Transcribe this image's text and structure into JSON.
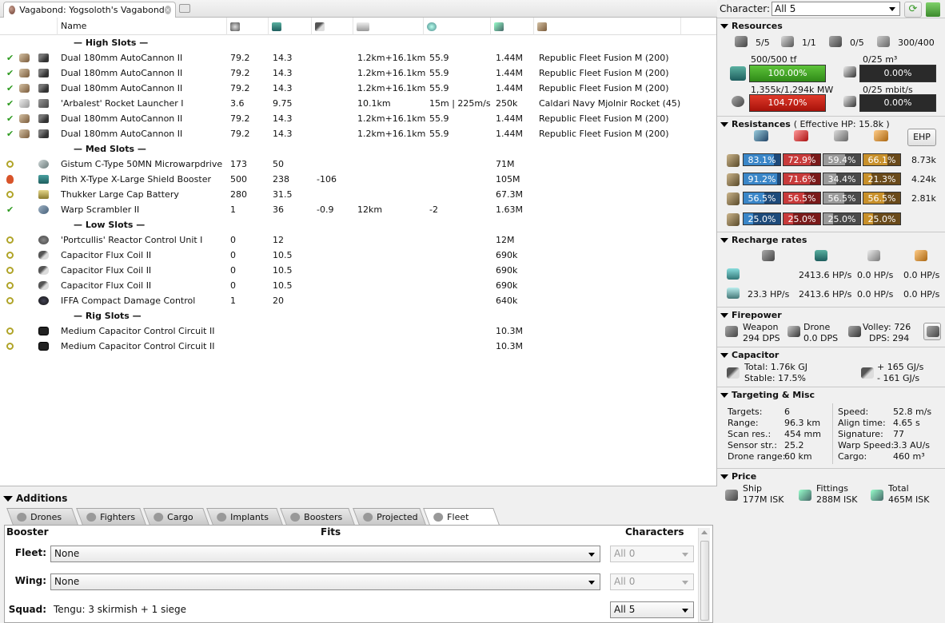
{
  "document_tab": {
    "title": "Vagabond: Yogsoloth's Vagabond",
    "close": "×"
  },
  "fitting": {
    "columns": {
      "name": "Name"
    },
    "rows": [
      {
        "section": "— High Slots —"
      },
      {
        "state": "check",
        "ammo_icon": true,
        "module_icon": "gun",
        "name": "Dual 180mm AutoCannon II",
        "cpu": "79.2",
        "pg": "14.3",
        "cap": "",
        "range": "1.2km+16.1km",
        "speed": "55.9",
        "price": "1.44M",
        "ammo": "Republic Fleet Fusion M (200)"
      },
      {
        "state": "check",
        "ammo_icon": true,
        "module_icon": "gun",
        "name": "Dual 180mm AutoCannon II",
        "cpu": "79.2",
        "pg": "14.3",
        "cap": "",
        "range": "1.2km+16.1km",
        "speed": "55.9",
        "price": "1.44M",
        "ammo": "Republic Fleet Fusion M (200)"
      },
      {
        "state": "check",
        "ammo_icon": true,
        "module_icon": "gun",
        "name": "Dual 180mm AutoCannon II",
        "cpu": "79.2",
        "pg": "14.3",
        "cap": "",
        "range": "1.2km+16.1km",
        "speed": "55.9",
        "price": "1.44M",
        "ammo": "Republic Fleet Fusion M (200)"
      },
      {
        "state": "check",
        "ammo_icon": "rocket",
        "module_icon": "launch",
        "name": "'Arbalest' Rocket Launcher I",
        "cpu": "3.6",
        "pg": "9.75",
        "cap": "",
        "range": "10.1km",
        "speed": "15m | 225m/s",
        "price": "250k",
        "ammo": "Caldari Navy Mjolnir Rocket (45)"
      },
      {
        "state": "check",
        "ammo_icon": true,
        "module_icon": "gun",
        "name": "Dual 180mm AutoCannon II",
        "cpu": "79.2",
        "pg": "14.3",
        "cap": "",
        "range": "1.2km+16.1km",
        "speed": "55.9",
        "price": "1.44M",
        "ammo": "Republic Fleet Fusion M (200)"
      },
      {
        "state": "check",
        "ammo_icon": true,
        "module_icon": "gun",
        "name": "Dual 180mm AutoCannon II",
        "cpu": "79.2",
        "pg": "14.3",
        "cap": "",
        "range": "1.2km+16.1km",
        "speed": "55.9",
        "price": "1.44M",
        "ammo": "Republic Fleet Fusion M (200)"
      },
      {
        "section": "— Med Slots —"
      },
      {
        "state": "ring",
        "module_icon": "mwd",
        "name": "Gistum C-Type 50MN Microwarpdrive",
        "cpu": "173",
        "pg": "50",
        "cap": "",
        "range": "",
        "speed": "",
        "price": "71M",
        "ammo": ""
      },
      {
        "state": "flame",
        "module_icon": "shield",
        "name": "Pith X-Type X-Large Shield Booster",
        "cpu": "500",
        "pg": "238",
        "cap": "-106",
        "range": "",
        "speed": "",
        "price": "105M",
        "ammo": ""
      },
      {
        "state": "ring",
        "module_icon": "cap",
        "name": "Thukker Large Cap Battery",
        "cpu": "280",
        "pg": "31.5",
        "cap": "",
        "range": "",
        "speed": "",
        "price": "67.3M",
        "ammo": ""
      },
      {
        "state": "check",
        "module_icon": "scram",
        "name": "Warp Scrambler II",
        "cpu": "1",
        "pg": "36",
        "cap": "-0.9",
        "range": "12km",
        "speed": "-2",
        "price": "1.63M",
        "ammo": ""
      },
      {
        "section": "— Low Slots —"
      },
      {
        "state": "ring",
        "module_icon": "rcu",
        "name": "'Portcullis' Reactor Control Unit I",
        "cpu": "0",
        "pg": "12",
        "cap": "",
        "range": "",
        "speed": "",
        "price": "12M",
        "ammo": ""
      },
      {
        "state": "ring",
        "module_icon": "flux",
        "name": "Capacitor Flux Coil II",
        "cpu": "0",
        "pg": "10.5",
        "cap": "",
        "range": "",
        "speed": "",
        "price": "690k",
        "ammo": ""
      },
      {
        "state": "ring",
        "module_icon": "flux",
        "name": "Capacitor Flux Coil II",
        "cpu": "0",
        "pg": "10.5",
        "cap": "",
        "range": "",
        "speed": "",
        "price": "690k",
        "ammo": ""
      },
      {
        "state": "ring",
        "module_icon": "flux",
        "name": "Capacitor Flux Coil II",
        "cpu": "0",
        "pg": "10.5",
        "cap": "",
        "range": "",
        "speed": "",
        "price": "690k",
        "ammo": ""
      },
      {
        "state": "ring",
        "module_icon": "dc",
        "name": "IFFA Compact Damage Control",
        "cpu": "1",
        "pg": "20",
        "cap": "",
        "range": "",
        "speed": "",
        "price": "640k",
        "ammo": ""
      },
      {
        "section": "— Rig Slots —"
      },
      {
        "state": "ring",
        "module_icon": "rig",
        "name": "Medium Capacitor Control Circuit II",
        "cpu": "",
        "pg": "",
        "cap": "",
        "range": "",
        "speed": "",
        "price": "10.3M",
        "ammo": ""
      },
      {
        "state": "ring",
        "module_icon": "rig",
        "name": "Medium Capacitor Control Circuit II",
        "cpu": "",
        "pg": "",
        "cap": "",
        "range": "",
        "speed": "",
        "price": "10.3M",
        "ammo": ""
      }
    ]
  },
  "additions": {
    "title": "Additions",
    "tabs": [
      "Drones",
      "Fighters",
      "Cargo",
      "Implants",
      "Boosters",
      "Projected",
      "Fleet"
    ],
    "active_tab": "Fleet",
    "booster_panel": {
      "col_booster": "Booster",
      "col_fits": "Fits",
      "col_characters": "Characters",
      "fleet_label": "Fleet:",
      "fleet_value": "None",
      "fleet_char": "All 0",
      "wing_label": "Wing:",
      "wing_value": "None",
      "wing_char": "All 0",
      "squad_label": "Squad:",
      "squad_value": "Tengu: 3 skirmish + 1 siege",
      "squad_char": "All 5"
    }
  },
  "character": {
    "label": "Character:",
    "value": "All 5"
  },
  "resources": {
    "title": "Resources",
    "turrets": "5/5",
    "launchers": "1/1",
    "drones_active": "0/5",
    "calibration": "300/400",
    "cpu_text": "500/500 tf",
    "cpu_pct": "100.00%",
    "pg_text": "1,355k/1,294k MW",
    "pg_pct": "104.70%",
    "drone_bay_text": "0/25 m³",
    "drone_bay_pct": "0.00%",
    "bandwidth_text": "0/25 mbit/s",
    "bandwidth_pct": "0.00%"
  },
  "resistances": {
    "title": "Resistances",
    "ehp_note": "( Effective HP: 15.8k )",
    "ehp_button": "EHP",
    "rows": [
      {
        "icon": "shield",
        "em": "83.1%",
        "th": "72.9%",
        "ki": "59.4%",
        "ex": "66.1%",
        "ehp": "8.73k",
        "v": [
          83.1,
          72.9,
          59.4,
          66.1
        ]
      },
      {
        "icon": "armor",
        "em": "91.2%",
        "th": "71.6%",
        "ki": "34.4%",
        "ex": "21.3%",
        "ehp": "4.24k",
        "v": [
          91.2,
          71.6,
          34.4,
          21.3
        ]
      },
      {
        "icon": "hull",
        "em": "56.5%",
        "th": "56.5%",
        "ki": "56.5%",
        "ex": "56.5%",
        "ehp": "2.81k",
        "v": [
          56.5,
          56.5,
          56.5,
          56.5
        ]
      },
      {
        "icon": "damage-pattern",
        "em": "25.0%",
        "th": "25.0%",
        "ki": "25.0%",
        "ex": "25.0%",
        "ehp": "",
        "v": [
          25,
          25,
          25,
          25
        ]
      }
    ]
  },
  "recharge": {
    "title": "Recharge rates",
    "row1": {
      "c1": "",
      "c2": "2413.6 HP/s",
      "c3": "0.0 HP/s",
      "c4": "0.0 HP/s"
    },
    "row2": {
      "c1": "23.3 HP/s",
      "c2": "2413.6 HP/s",
      "c3": "0.0 HP/s",
      "c4": "0.0 HP/s"
    }
  },
  "firepower": {
    "title": "Firepower",
    "weapon_label": "Weapon",
    "weapon_dps": "294 DPS",
    "drone_label": "Drone",
    "drone_dps": "0.0 DPS",
    "volley": "Volley: 726",
    "dps": "DPS: 294"
  },
  "capacitor": {
    "title": "Capacitor",
    "total": "Total: 1.76k GJ",
    "stable": "Stable: 17.5%",
    "plus": "+ 165 GJ/s",
    "minus": "- 161 GJ/s"
  },
  "targeting": {
    "title": "Targeting & Misc",
    "left": [
      {
        "k": "Targets:",
        "v": "6"
      },
      {
        "k": "Range:",
        "v": "96.3 km"
      },
      {
        "k": "Scan res.:",
        "v": "454 mm"
      },
      {
        "k": "Sensor str.:",
        "v": "25.2"
      },
      {
        "k": "Drone range:",
        "v": "60 km"
      }
    ],
    "right": [
      {
        "k": "Speed:",
        "v": "52.8 m/s"
      },
      {
        "k": "Align time:",
        "v": "4.65 s"
      },
      {
        "k": "Signature:",
        "v": "77"
      },
      {
        "k": "Warp Speed:",
        "v": "3.3 AU/s"
      },
      {
        "k": "Cargo:",
        "v": "460 m³"
      }
    ]
  },
  "price": {
    "title": "Price",
    "ship_label": "Ship",
    "ship_value": "177M ISK",
    "fittings_label": "Fittings",
    "fittings_value": "288M ISK",
    "total_label": "Total",
    "total_value": "465M ISK"
  },
  "colors": {
    "cpu_ok": "#2f8a18",
    "over": "#a8120a",
    "em": "#3a86c8",
    "thermal": "#c83a3a",
    "kinetic": "#9a9a9a",
    "explosive": "#c8902a"
  }
}
